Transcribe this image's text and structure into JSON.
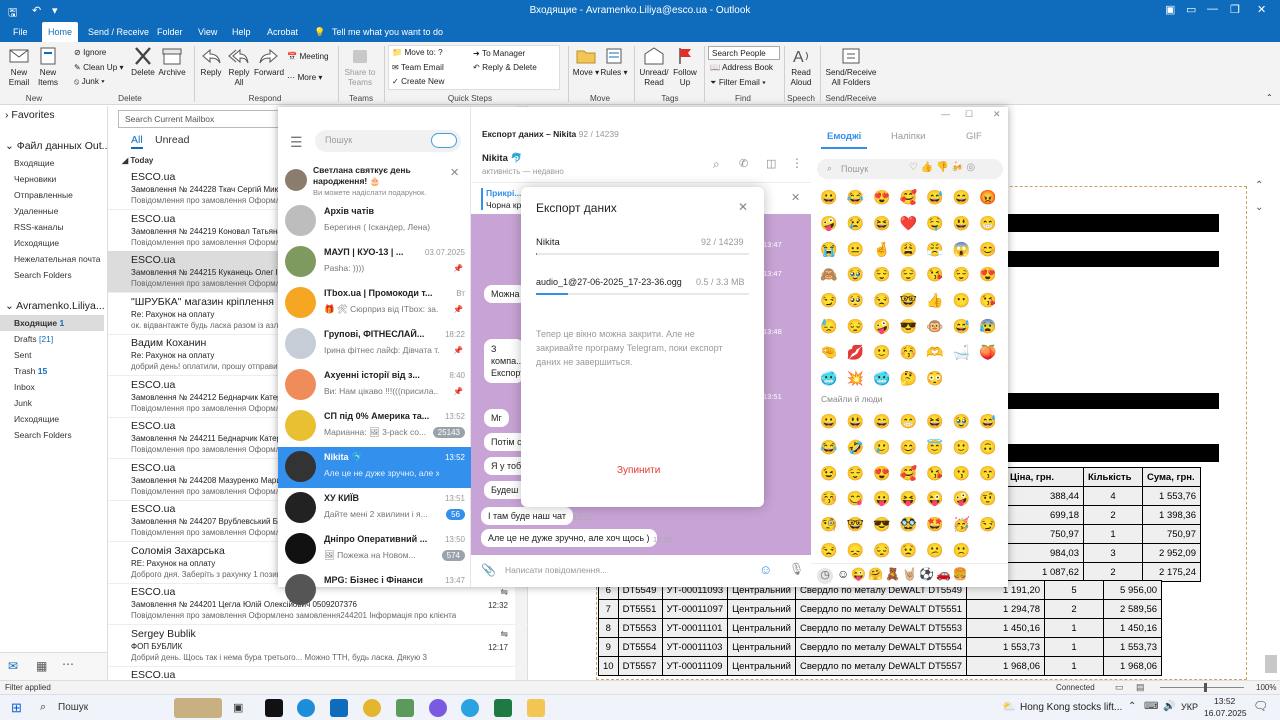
{
  "window": {
    "title": "Входящие - Avramenko.Liliya@esco.ua - Outlook"
  },
  "menu": [
    "File",
    "Home",
    "Send / Receive",
    "Folder",
    "View",
    "Help",
    "Acrobat"
  ],
  "tellme": "Tell me what you want to do",
  "ribbon": {
    "new_email": "New\nEmail",
    "new_items": "New\nItems",
    "ignore": "Ignore",
    "cleanup": "Clean Up",
    "junk": "Junk",
    "delete": "Delete",
    "archive": "Archive",
    "reply": "Reply",
    "reply_all": "Reply\nAll",
    "forward": "Forward",
    "meeting": "Meeting",
    "more": "More",
    "share_teams": "Share to\nTeams",
    "move_to": "Move to: ?",
    "team_email": "Team Email",
    "create_new": "Create New",
    "to_manager": "To Manager",
    "reply_delete": "Reply & Delete",
    "move": "Move",
    "rules": "Rules",
    "unread_read": "Unread/\nRead",
    "follow_up": "Follow\nUp",
    "search_people": "Search People",
    "address_book": "Address Book",
    "filter_email": "Filter Email",
    "read_aloud": "Read\nAloud",
    "send_receive_all": "Send/Receive\nAll Folders",
    "groups": [
      "New",
      "Delete",
      "Respond",
      "Teams",
      "Quick Steps",
      "Move",
      "Tags",
      "Find",
      "Speech",
      "Send/Receive"
    ]
  },
  "nav": {
    "favorites": "Favorites",
    "datafile": "Файл данных Out...",
    "folders1": [
      "Входящие",
      "Черновики",
      "Отправленные",
      "Удаленные",
      "RSS-каналы",
      "Исходящие",
      "Нежелательная почта",
      "Search Folders"
    ],
    "account": "Avramenko.Liliya...",
    "folders2": [
      {
        "n": "Входящие",
        "c": "1"
      },
      {
        "n": "Drafts",
        "c": "[21]"
      },
      {
        "n": "Sent",
        "c": ""
      },
      {
        "n": "Trash",
        "c": "15"
      },
      {
        "n": "Inbox",
        "c": ""
      },
      {
        "n": "Junk",
        "c": ""
      },
      {
        "n": "Исходящие",
        "c": ""
      },
      {
        "n": "Search Folders",
        "c": ""
      }
    ]
  },
  "list": {
    "search": "Search Current Mailbox",
    "all": "All",
    "unread": "Unread",
    "group": "Today",
    "items": [
      {
        "s": "ESCO.ua",
        "sub": "Замовлення № 244228 Ткач Сергій Миколаї...",
        "pv": "Повідомлення про замовлення  Оформле...",
        "tm": ""
      },
      {
        "s": "ESCO.ua",
        "sub": "Замовлення № 244219 Коновал Татьяна П...",
        "pv": "Повідомлення про замовлення  Оформле...",
        "tm": ""
      },
      {
        "s": "ESCO.ua",
        "sub": "Замовлення № 244215 Куканець Олег Іванович...",
        "pv": "Повідомлення про замовлення  Оформле...",
        "tm": ""
      },
      {
        "s": "\"ШРУБКА\" магазин кріплення",
        "sub": "Re: Рахунок на оплату",
        "pv": "ок. відвантажте будь ласка разом із азлер...",
        "tm": ""
      },
      {
        "s": "Вадим Коханин",
        "sub": "Re: Рахунок на оплату",
        "pv": "добрий день! оплатили, прошу отправити...",
        "tm": ""
      },
      {
        "s": "ESCO.ua",
        "sub": "Замовлення № 244212 Беднарчик Катерина...",
        "pv": "Повідомлення про замовлення  Оформле...",
        "tm": ""
      },
      {
        "s": "ESCO.ua",
        "sub": "Замовлення № 244211 Беднарчик Катерина...",
        "pv": "Повідомлення про замовлення  Оформле...",
        "tm": ""
      },
      {
        "s": "ESCO.ua",
        "sub": "Замовлення № 244208 Мазуренко Марина...",
        "pv": "Повідомлення про замовлення  Оформле...",
        "tm": ""
      },
      {
        "s": "ESCO.ua",
        "sub": "Замовлення № 244207 Врублевський Богдан...",
        "pv": "Повідомлення про замовлення  Оформле...",
        "tm": ""
      },
      {
        "s": "Соломія Захарська",
        "sub": "RE: Рахунок на оплату",
        "pv": "Доброго дня. Заберіть з рахунку 1 позицію...",
        "tm": ""
      },
      {
        "s": "ESCO.ua",
        "sub": "Замовлення № 244201 Цегла Юлій Олексійович 0509207376",
        "pv": "Повідомлення про замовлення  Оформлено замовлення244201  Інформація про клієнта",
        "tm": "12:32"
      },
      {
        "s": "Sergey Bublik",
        "sub": "ФОП БУБЛИК",
        "pv": "Добрий день. Щось так і нема бура третього...  Можно ТТН, будь ласка.  Дякую  3",
        "tm": "12:17"
      },
      {
        "s": "ESCO.ua",
        "sub": "",
        "pv": "",
        "tm": ""
      }
    ]
  },
  "telegram": {
    "search": "Пошук",
    "birthday_title": "Светлана святкує день народження! 🎂",
    "birthday_sub": "Ви можете надіслати подарунок.",
    "chats": [
      {
        "n": "Архів чатів",
        "m": "Берегиня ( Іскандер, Лена)",
        "t": "",
        "b": "",
        "c": "#bdbdbd"
      },
      {
        "n": "МАУП | КУО-13 | ...",
        "m": "Pasha: ))))",
        "t": "03.07.2025",
        "b": "",
        "c": "#7e9a5e"
      },
      {
        "n": "ITbox.ua | Промокоди т...",
        "m": "🎁 🛠 Сюрприз від ITbox: за...",
        "t": "Вт",
        "b": "",
        "c": "#f5a623"
      },
      {
        "n": "Групові, ФІТНЕСЛАЙ...",
        "m": "Ірина фітнес лайф: Дівчата т...",
        "t": "18:22",
        "b": "",
        "c": "#c7cdd6"
      },
      {
        "n": "Ахуенні історії від з...",
        "m": "Ви: Нам цікаво !!!(((присила...",
        "t": "8:40",
        "b": "",
        "c": "#f08c5a"
      },
      {
        "n": "СП під 0% Америка та...",
        "m": "Марианна: 🖼 3-pack co...",
        "t": "13:52",
        "b": "25143",
        "c": "#e8c032"
      },
      {
        "n": "Nikita 🐬",
        "m": "Але це не дуже зручно, але хоч...",
        "t": "13:52",
        "b": "",
        "c": "#333"
      },
      {
        "n": "ХУ КИЇВ",
        "m": "Дайте мені 2 хвилини і я...",
        "t": "13:51",
        "b": "56",
        "c": "#222"
      },
      {
        "n": "Дніпро Оперативний ...",
        "m": "🖼 Пожежа на Новом...",
        "t": "13:50",
        "b": "574",
        "c": "#111"
      },
      {
        "n": "МРG: Бізнес і Фінанси",
        "m": "",
        "t": "13:47",
        "b": "",
        "c": "#555"
      }
    ],
    "header_left": "Експорт даних – Nikita",
    "header_count": "92 / 14239",
    "peer": "Nikita 🐬",
    "peer_status": "активність — недавно",
    "pinned_title": "Прикрі...",
    "pinned_text": "Чорна кр...",
    "bubbles": [
      "Можна",
      "З компа... Експорт",
      "Мг",
      "Потім ск",
      "Я у тобі з",
      "Будеш п",
      "І там буде наш чат",
      "Але це не дуже зручно, але хоч щось )"
    ],
    "bubble_times": [
      "13:52",
      "13:52"
    ],
    "bubble_right_times": [
      "13:47",
      "13:47",
      "13:48",
      "13:51"
    ],
    "input_placeholder": "Написати повідомлення...",
    "export": {
      "title": "Експорт даних",
      "chat": "Nikita",
      "chat_count": "92 / 14239",
      "file": "audio_1@27-06-2025_17-23-36.ogg",
      "file_size": "0.5 / 3.3 МВ",
      "info": "Тепер це вікно можна закрити. Але не закривайте програму Telegram, поки експорт даних не завершиться.",
      "stop": "Зупинити",
      "chat_progress": 0.006,
      "file_progress": 0.15
    },
    "emoji_tabs": [
      "Емоджі",
      "Наліпки",
      "GIF"
    ],
    "emoji_search": "Пошук",
    "emoji_section": "Смайли й люди",
    "emoji_top": [
      "😀",
      "😂",
      "😍",
      "🥰",
      "😅",
      "😄",
      "😡",
      "🤪",
      "😢",
      "😆",
      "❤️",
      "🤤",
      "😃",
      "😁",
      "😭",
      "😐",
      "🤞",
      "😩",
      "😤",
      "😱",
      "😊",
      "🙈",
      "🥹",
      "😌",
      "😌",
      "😘",
      "😌",
      "😍",
      "😏",
      "🥺",
      "😒",
      "🤓",
      "👍",
      "😶",
      "😘",
      "😓",
      "😔",
      "🤪",
      "😎",
      "🐵",
      "😅",
      "😰",
      "🤏",
      "💋",
      "🙂",
      "😚",
      "🫶",
      "🛁",
      "🍑",
      "🥶",
      "💥",
      "🥶",
      "🤔",
      "😳"
    ],
    "emoji_bottom": [
      "😀",
      "😃",
      "😄",
      "😁",
      "😆",
      "🥹",
      "😅",
      "😂",
      "🤣",
      "🥲",
      "😊",
      "😇",
      "🙂",
      "🙃",
      "😉",
      "😌",
      "😍",
      "🥰",
      "😘",
      "😗",
      "😙",
      "😚",
      "😋",
      "😛",
      "😝",
      "😜",
      "🤪",
      "🤨",
      "🧐",
      "🤓",
      "😎",
      "🥸",
      "🤩",
      "🥳",
      "😏",
      "😒",
      "😞",
      "😔",
      "😟",
      "😕",
      "🙁"
    ]
  },
  "reading": {
    "headers": [
      "Ціна, грн.",
      "Кількість",
      "Сума, грн."
    ],
    "rows_top": [
      [
        "388,44",
        "4",
        "1 553,76"
      ],
      [
        "699,18",
        "2",
        "1 398,36"
      ],
      [
        "750,97",
        "1",
        "750,97"
      ],
      [
        "984,03",
        "3",
        "2 952,09"
      ],
      [
        "1 087,62",
        "2",
        "2 175,24"
      ]
    ],
    "rows": [
      [
        "6",
        "DT5549",
        "УТ-00011093",
        "Центральний",
        "Свердло по металу DeWALT DT5549",
        "1 191,20",
        "5",
        "5 956,00"
      ],
      [
        "7",
        "DT5551",
        "УТ-00011097",
        "Центральний",
        "Свердло по металу DeWALT DT5551",
        "1 294,78",
        "2",
        "2 589,56"
      ],
      [
        "8",
        "DT5553",
        "УТ-00011101",
        "Центральний",
        "Свердло по металу DeWALT DT5553",
        "1 450,16",
        "1",
        "1 450,16"
      ],
      [
        "9",
        "DT5554",
        "УТ-00011103",
        "Центральний",
        "Свердло по металу DeWALT DT5554",
        "1 553,73",
        "1",
        "1 553,73"
      ],
      [
        "10",
        "DT5557",
        "УТ-00011109",
        "Центральний",
        "Свердло по металу DeWALT DT5557",
        "1 968,06",
        "1",
        "1 968,06"
      ]
    ]
  },
  "status": {
    "left": "Filter applied",
    "connected": "Connected",
    "zoom": "100%"
  },
  "taskbar": {
    "search": "Пошук",
    "news": "Hong Kong stocks lift...",
    "lang": "УКР",
    "time": "13:52",
    "date": "16.07.2025"
  }
}
